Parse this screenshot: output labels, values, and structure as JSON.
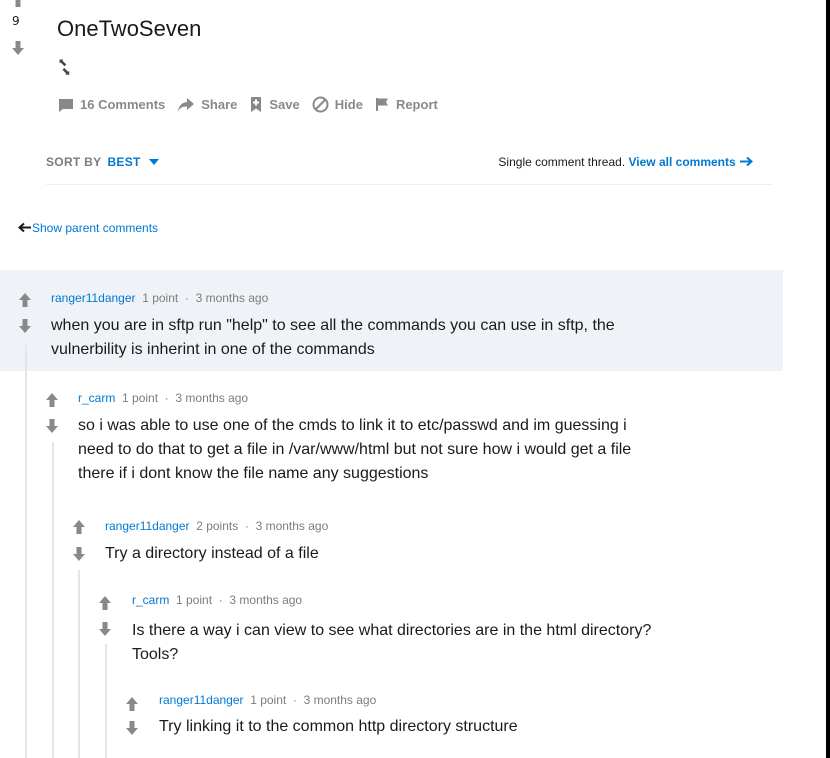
{
  "post": {
    "score": "9",
    "title": "OneTwoSeven",
    "actions": {
      "comments": "16 Comments",
      "share": "Share",
      "save": "Save",
      "hide": "Hide",
      "report": "Report"
    }
  },
  "sort": {
    "label": "SORT BY",
    "value": "BEST"
  },
  "thread_note": {
    "text": "Single comment thread. ",
    "link": "View all comments"
  },
  "parent_link": "Show parent comments",
  "comments": [
    {
      "author": "ranger11danger",
      "points": "1 point",
      "time": "3 months ago",
      "lines": [
        "when you are in sftp run \"help\" to see all the commands you can use in sftp, the",
        "vulnerbility is inherint in one of the commands"
      ]
    },
    {
      "author": "r_carm",
      "points": "1 point",
      "time": "3 months ago",
      "lines": [
        "so i was able to use one of the cmds to link it to etc/passwd and im guessing i",
        "need to do that to get a file in /var/www/html but not sure how i would get a file",
        "there if i dont know the file name any suggestions"
      ]
    },
    {
      "author": "ranger11danger",
      "points": "2 points",
      "time": "3 months ago",
      "lines": [
        "Try a directory instead of a file"
      ]
    },
    {
      "author": "r_carm",
      "points": "1 point",
      "time": "3 months ago",
      "lines": [
        "Is there a way i can view to see what directories are in the html directory?",
        "Tools?"
      ]
    },
    {
      "author": "ranger11danger",
      "points": "1 point",
      "time": "3 months ago",
      "lines": [
        "Try linking it to the common http directory structure"
      ]
    }
  ],
  "colors": {
    "accent": "#0079d3",
    "meta": "#7c7c7c",
    "highlight": "#eff3f7",
    "icon": "#878a8c",
    "vote": "#878a8c"
  }
}
